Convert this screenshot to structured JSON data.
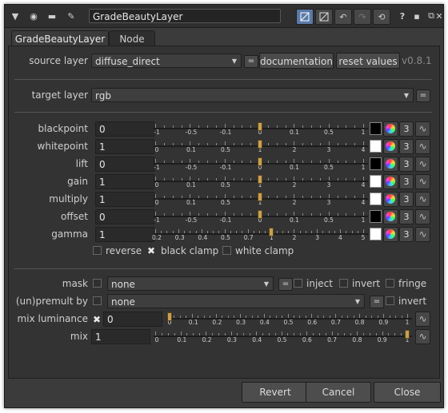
{
  "titlebar": {
    "node_name": "GradeBeautyLayer",
    "icons": [
      "collapse-arrow-icon",
      "center-node-icon",
      "node-color-icon",
      "settings-wrench-icon",
      "toggle-edit-icon",
      "float-window-icon",
      "undo-icon",
      "redo-icon",
      "revert-icon",
      "help-icon",
      "minimize-icon",
      "maximize-icon",
      "close-icon"
    ]
  },
  "tabs": [
    {
      "label": "GradeBeautyLayer"
    },
    {
      "label": "Node"
    }
  ],
  "source_layer": {
    "label": "source layer",
    "value": "diffuse_direct",
    "eq": "=",
    "documentation": "documentation",
    "reset": "reset values",
    "version": "v0.8.1"
  },
  "target_layer": {
    "label": "target layer",
    "value": "rgb",
    "eq": "="
  },
  "grade_rows": [
    {
      "label": "blackpoint",
      "value": "0",
      "ticks": [
        "-1",
        "-0.5",
        "-0.1",
        "0",
        "0.1",
        "0.5",
        "1"
      ],
      "swatch": "#000000",
      "channels": "3"
    },
    {
      "label": "whitepoint",
      "value": "1",
      "ticks": [
        "0",
        "0.1",
        "0.5",
        "1",
        "2",
        "3",
        "4"
      ],
      "swatch": "#ffffff",
      "channels": "3"
    },
    {
      "label": "lift",
      "value": "0",
      "ticks": [
        "-1",
        "-0.5",
        "-0.1",
        "0",
        "0.1",
        "0.5",
        "1"
      ],
      "swatch": "#000000",
      "channels": "3"
    },
    {
      "label": "gain",
      "value": "1",
      "ticks": [
        "0",
        "0.1",
        "0.5",
        "1",
        "2",
        "3",
        "4"
      ],
      "swatch": "#ffffff",
      "channels": "3"
    },
    {
      "label": "multiply",
      "value": "1",
      "ticks": [
        "0",
        "0.1",
        "0.5",
        "1",
        "2",
        "3",
        "4"
      ],
      "swatch": "#ffffff",
      "channels": "3"
    },
    {
      "label": "offset",
      "value": "0",
      "ticks": [
        "-1",
        "-0.5",
        "-0.1",
        "0",
        "0.1",
        "0.5",
        "1"
      ],
      "swatch": "#000000",
      "channels": "3"
    },
    {
      "label": "gamma",
      "value": "1",
      "ticks": [
        "0.2",
        "0.3",
        "0.4",
        "0.5",
        "0.7",
        "1",
        "2",
        "3",
        "4",
        "5"
      ],
      "swatch": "#ffffff",
      "channels": "3"
    }
  ],
  "clamp_options": {
    "reverse": "reverse",
    "black_clamp": "black clamp",
    "white_clamp": "white clamp"
  },
  "mask": {
    "label": "mask",
    "value": "none",
    "eq": "=",
    "inject": "inject",
    "invert": "invert",
    "fringe": "fringe"
  },
  "unpremult": {
    "label": "(un)premult by",
    "value": "none",
    "eq": "=",
    "invert": "invert"
  },
  "mix_luminance": {
    "label": "mix luminance",
    "value": "0",
    "ticks": [
      "0",
      "0.1",
      "0.2",
      "0.3",
      "0.4",
      "0.5",
      "0.6",
      "0.7",
      "0.8",
      "0.9",
      "1"
    ]
  },
  "mix": {
    "label": "mix",
    "value": "1",
    "ticks": [
      "0",
      "0.1",
      "0.2",
      "0.3",
      "0.4",
      "0.5",
      "0.6",
      "0.7",
      "0.8",
      "0.9",
      "1"
    ]
  },
  "footer": {
    "revert": "Revert",
    "cancel": "Cancel",
    "close": "Close"
  }
}
